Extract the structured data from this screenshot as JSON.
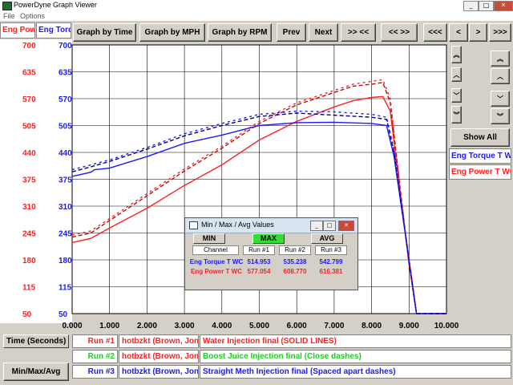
{
  "window": {
    "title": "PowerDyne Graph Viewer",
    "minimize": "_",
    "maximize": "□",
    "close": "✕"
  },
  "menu": [
    "File",
    "Options"
  ],
  "tabs": {
    "power": "Eng Pow",
    "torque": "Eng Torq"
  },
  "toolbar": {
    "by_time": "Graph by Time",
    "by_mph": "Graph by MPH",
    "by_rpm": "Graph by RPM",
    "prev": "Prev",
    "next": "Next",
    "zoom_in": ">> <<",
    "zoom_out": "<< >>",
    "first": "<<<",
    "left": "<",
    "right": ">",
    "last": ">>>"
  },
  "scroll": {
    "up_double_left": "︽",
    "up_left": "︿",
    "down_left": "﹀",
    "down_double_left": "︾",
    "up_double_right": "︽",
    "up_right": "︿",
    "down_right": "﹀",
    "down_double_right": "︾"
  },
  "show_all": "Show All",
  "channels": {
    "torque": "Eng Torque T WC",
    "power": "Eng Power T WC"
  },
  "colors": {
    "power": "#ff2020",
    "torque": "#1a1aff",
    "green": "#22cc22",
    "grid": "#000000"
  },
  "chart_data": {
    "type": "line",
    "xlim": [
      0,
      10
    ],
    "xticks": [
      "0.000",
      "1.000",
      "2.000",
      "3.000",
      "4.000",
      "5.000",
      "6.000",
      "7.000",
      "8.000",
      "9.000",
      "10.000"
    ],
    "y_left_power": [
      "700",
      "635",
      "570",
      "505",
      "440",
      "375",
      "310",
      "245",
      "180",
      "115",
      "50"
    ],
    "y_left_torque": [
      "700",
      "635",
      "570",
      "505",
      "440",
      "375",
      "310",
      "245",
      "180",
      "115",
      "50"
    ],
    "ylim": [
      50,
      700
    ],
    "series": [
      {
        "name": "Eng Power T WC Run #1",
        "style": "solid",
        "color": "#ff2020",
        "x": [
          0,
          0.5,
          1,
          2,
          3,
          4,
          5,
          6,
          7,
          7.5,
          8,
          8.3,
          8.5,
          8.7,
          9,
          9.2,
          9.3,
          10
        ],
        "y": [
          222,
          232,
          257,
          305,
          360,
          410,
          470,
          515,
          550,
          565,
          573,
          575,
          540,
          390,
          170,
          50,
          50,
          50
        ]
      },
      {
        "name": "Eng Power T WC Run #2",
        "style": "dashed",
        "color": "#b01010",
        "x": [
          0,
          0.5,
          1,
          2,
          3,
          4,
          5,
          6,
          7,
          7.5,
          8,
          8.3,
          8.5,
          8.7,
          9,
          9.2,
          9.3,
          10
        ],
        "y": [
          235,
          245,
          275,
          335,
          395,
          450,
          510,
          555,
          585,
          600,
          605,
          609,
          560,
          400,
          170,
          50,
          50,
          50
        ]
      },
      {
        "name": "Eng Power T WC Run #3",
        "style": "spaced",
        "color": "#ff2020",
        "x": [
          0,
          0.5,
          1,
          2,
          3,
          4,
          5,
          6,
          7,
          7.5,
          8,
          8.3,
          8.5,
          8.7,
          9,
          9.2,
          9.3,
          10
        ],
        "y": [
          240,
          250,
          280,
          340,
          400,
          455,
          515,
          560,
          590,
          605,
          612,
          616,
          570,
          405,
          170,
          50,
          50,
          50
        ]
      },
      {
        "name": "Eng Torque T WC Run #1",
        "style": "solid",
        "color": "#1a1aff",
        "x": [
          0,
          0.5,
          0.6,
          1,
          2,
          3,
          4,
          5,
          6,
          7,
          8,
          8.4,
          8.6,
          9,
          9.2,
          9.3,
          10
        ],
        "y": [
          382,
          392,
          398,
          402,
          430,
          462,
          482,
          505,
          512,
          513,
          510,
          505,
          430,
          180,
          50,
          50,
          50
        ]
      },
      {
        "name": "Eng Torque T WC Run #2",
        "style": "dashed",
        "color": "#000080",
        "x": [
          0,
          0.5,
          1,
          2,
          3,
          4,
          5,
          6,
          7,
          8,
          8.4,
          8.6,
          9,
          9.2,
          9.3,
          10
        ],
        "y": [
          393,
          405,
          418,
          448,
          480,
          505,
          527,
          535,
          530,
          525,
          520,
          440,
          180,
          50,
          50,
          50
        ]
      },
      {
        "name": "Eng Torque T WC Run #3",
        "style": "spaced",
        "color": "#1a1aff",
        "x": [
          0,
          0.5,
          1,
          2,
          3,
          4,
          5,
          6,
          7,
          8,
          8.4,
          8.6,
          9,
          9.2,
          9.3,
          10
        ],
        "y": [
          398,
          410,
          422,
          452,
          485,
          510,
          532,
          540,
          538,
          532,
          525,
          445,
          180,
          50,
          50,
          50
        ]
      }
    ]
  },
  "minmax": {
    "title": "Min / Max / Avg Values",
    "min": "MIN",
    "max": "MAX",
    "avg": "AVG",
    "headers": [
      "Channel",
      "Run #1",
      "Run #2",
      "Run #3"
    ],
    "rows": [
      {
        "channel": "Eng Torque T WC",
        "run1": "514.953",
        "run2": "535.238",
        "run3": "542.799"
      },
      {
        "channel": "Eng Power T WC",
        "run1": "577.054",
        "run2": "608.770",
        "run3": "616.381"
      }
    ]
  },
  "legend": {
    "time_label": "Time (Seconds)",
    "minmax_button": "Min/Max/Avg",
    "runs": [
      {
        "run": "Run #1",
        "name": "hotbzkt (Brown, Jon)",
        "desc": "Water Injection final (SOLID LINES)",
        "color": "#ff2020"
      },
      {
        "run": "Run #2",
        "name": "hotbzkt (Brown, Jon)",
        "desc": "Boost Juice Injection final (Close dashes)",
        "color": "#22cc22"
      },
      {
        "run": "Run #3",
        "name": "hotbzkt (Brown, Jon)",
        "desc": "Straight Meth Injection final (Spaced apart dashes)",
        "color": "#1a1aff"
      }
    ]
  }
}
